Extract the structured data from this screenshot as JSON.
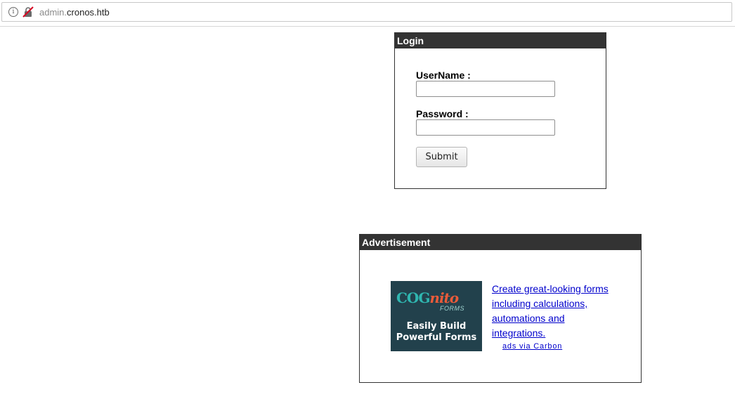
{
  "browser": {
    "url_subdomain": "admin.",
    "url_host": "cronos.htb",
    "info_icon": "info-icon",
    "insecure_icon": "insecure-connection-icon"
  },
  "login": {
    "header": "Login",
    "username_label": "UserName :",
    "username_value": "",
    "password_label": "Password :",
    "password_value": "",
    "submit_label": "Submit"
  },
  "advertisement": {
    "header": "Advertisement",
    "image_brand_prefix": "COG",
    "image_brand_suffix": "nito",
    "image_brand_sub": "FORMS",
    "image_tagline_line1": "Easily Build",
    "image_tagline_line2": "Powerful Forms",
    "link_text": "Create great-looking forms including calculations, automations and integrations.",
    "via_text": "ads via Carbon",
    "colors": {
      "image_bg": "#22414c",
      "brand_teal": "#2fb6b0",
      "brand_orange": "#ea5b3a",
      "link": "#0000cc"
    }
  }
}
